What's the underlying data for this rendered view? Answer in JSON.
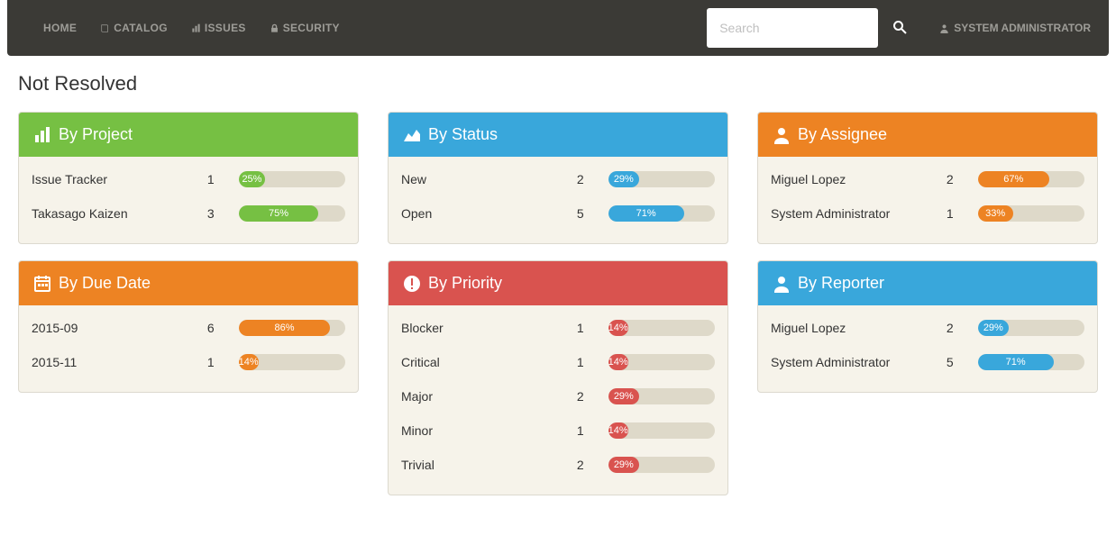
{
  "nav": {
    "home": "HOME",
    "catalog": "CATALOG",
    "issues": "ISSUES",
    "security": "SECURITY",
    "search_placeholder": "Search",
    "user": "SYSTEM ADMINISTRATOR"
  },
  "page_title": "Not Resolved",
  "panels": [
    {
      "id": "project",
      "title": "By Project",
      "color": "green",
      "icon": "bar-chart",
      "rows": [
        {
          "label": "Issue Tracker",
          "count": 1,
          "pct": 25
        },
        {
          "label": "Takasago Kaizen",
          "count": 3,
          "pct": 75
        }
      ]
    },
    {
      "id": "status",
      "title": "By Status",
      "color": "blue",
      "icon": "area-chart",
      "rows": [
        {
          "label": "New",
          "count": 2,
          "pct": 29
        },
        {
          "label": "Open",
          "count": 5,
          "pct": 71
        }
      ]
    },
    {
      "id": "assignee",
      "title": "By Assignee",
      "color": "orange",
      "icon": "user",
      "rows": [
        {
          "label": "Miguel Lopez",
          "count": 2,
          "pct": 67
        },
        {
          "label": "System Administrator",
          "count": 1,
          "pct": 33
        }
      ]
    },
    {
      "id": "duedate",
      "title": "By Due Date",
      "color": "orange",
      "icon": "calendar",
      "rows": [
        {
          "label": "2015-09",
          "count": 6,
          "pct": 86
        },
        {
          "label": "2015-11",
          "count": 1,
          "pct": 14
        }
      ]
    },
    {
      "id": "priority",
      "title": "By Priority",
      "color": "red",
      "icon": "exclaim",
      "rows": [
        {
          "label": "Blocker",
          "count": 1,
          "pct": 14
        },
        {
          "label": "Critical",
          "count": 1,
          "pct": 14
        },
        {
          "label": "Major",
          "count": 2,
          "pct": 29
        },
        {
          "label": "Minor",
          "count": 1,
          "pct": 14
        },
        {
          "label": "Trivial",
          "count": 2,
          "pct": 29
        }
      ]
    },
    {
      "id": "reporter",
      "title": "By Reporter",
      "color": "blue",
      "icon": "user",
      "rows": [
        {
          "label": "Miguel Lopez",
          "count": 2,
          "pct": 29
        },
        {
          "label": "System Administrator",
          "count": 5,
          "pct": 71
        }
      ]
    }
  ]
}
